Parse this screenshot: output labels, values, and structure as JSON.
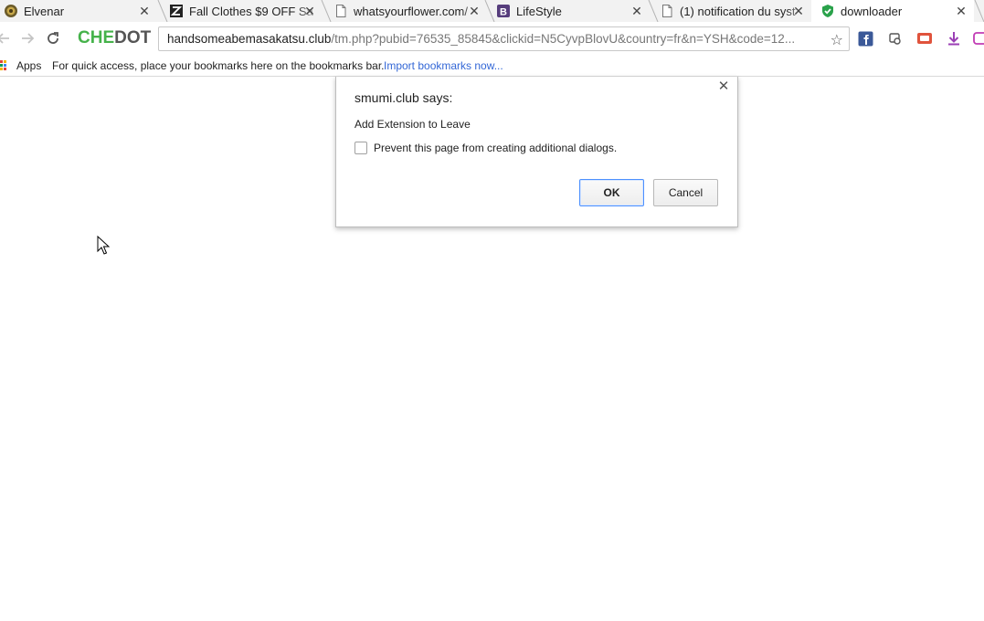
{
  "tabs": [
    {
      "title": "Elvenar",
      "icon": "elvenar-icon"
    },
    {
      "title": "Fall Clothes $9 OFF Sa",
      "icon": "zaful-z-icon"
    },
    {
      "title": "whatsyourflower.com/",
      "icon": "page-icon"
    },
    {
      "title": "LifeStyle",
      "icon": "bootstrap-b-icon"
    },
    {
      "title": "(1) notification du syst",
      "icon": "page-icon"
    },
    {
      "title": "downloader",
      "icon": "green-shield-check-icon",
      "active": true
    }
  ],
  "toolbar": {
    "brand_part1": "CHE",
    "brand_part2": "DOT",
    "url_host": "handsomeabemasakatsu.club",
    "url_path": "/tm.php?pubid=76535_85845&clickid=N5CyvpBlovU&country=fr&n=YSH&code=12..."
  },
  "bookmarks": {
    "apps_label": "Apps",
    "hint": "For quick access, place your bookmarks here on the bookmarks bar.",
    "import_link": "Import bookmarks now..."
  },
  "dialog": {
    "title": "smumi.club says:",
    "message": "Add Extension to Leave",
    "checkbox_label": "Prevent this page from creating additional dialogs.",
    "checkbox_checked": false,
    "ok_label": "OK",
    "cancel_label": "Cancel"
  },
  "colors": {
    "brand_green": "#45b24a",
    "link_blue": "#3367d6",
    "focus_blue": "#4d90fe"
  }
}
